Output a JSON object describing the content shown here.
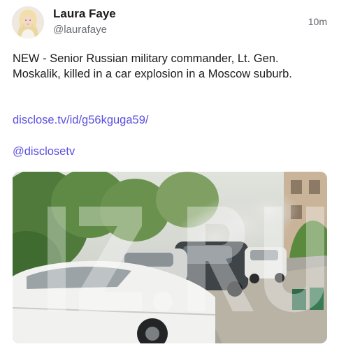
{
  "author": {
    "display_name": "Laura Faye",
    "handle": "@laurafaye"
  },
  "timestamp": "10m",
  "post": {
    "text": "NEW - Senior Russian military commander, Lt. Gen. Moskalik, killed in a car explosion in a Moscow suburb.",
    "link": "disclose.tv/id/g56kguga59/",
    "mention": "@disclosetv"
  },
  "media": {
    "watermark": "IZ.RU"
  },
  "colors": {
    "link": "#5b4fe0",
    "text": "#1b1b1f",
    "muted": "#6b6e76"
  },
  "icons": {
    "avatar": "profile-photo",
    "media": "video-still-image"
  }
}
